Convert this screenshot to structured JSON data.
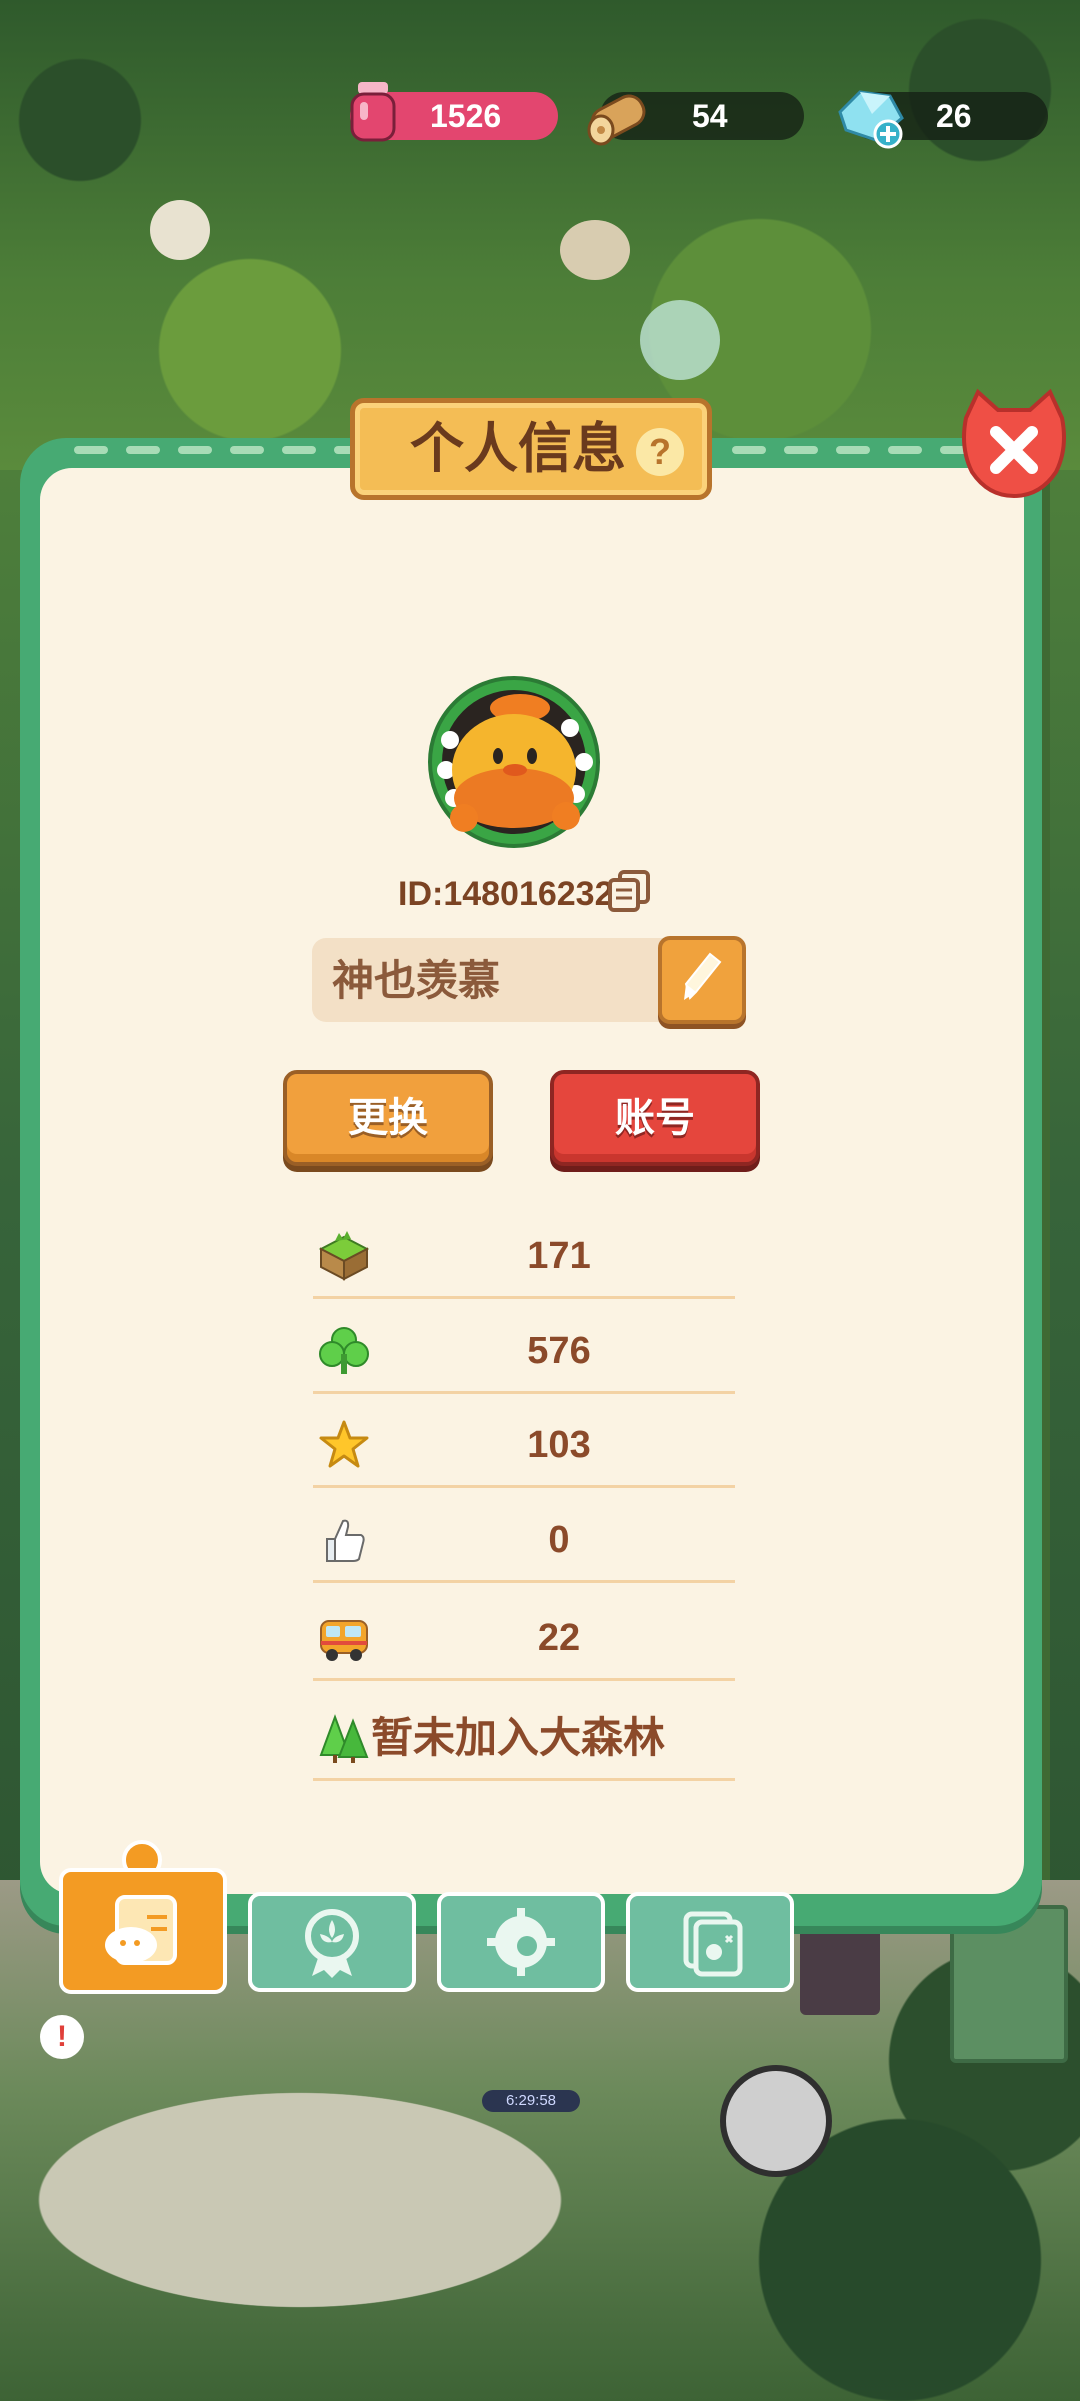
{
  "resources": {
    "ink": {
      "value": "1526",
      "icon": "ink-jar-icon"
    },
    "wood": {
      "value": "54",
      "icon": "wood-log-icon"
    },
    "gem": {
      "value": "26",
      "icon": "gem-plus-icon"
    }
  },
  "panel": {
    "title": "个人信息",
    "help_label": "?",
    "player_id": "ID:148016232",
    "player_name": "神也羡慕",
    "change_button": "更换",
    "account_button": "账号"
  },
  "stats": [
    {
      "icon": "grass-block-icon",
      "value": "171"
    },
    {
      "icon": "clover-icon",
      "value": "576"
    },
    {
      "icon": "star-icon",
      "value": "103"
    },
    {
      "icon": "thumbs-up-icon",
      "value": "0"
    },
    {
      "icon": "bus-icon",
      "value": "22"
    },
    {
      "icon": "forest-icon",
      "value": "暂未加入大森林"
    }
  ],
  "tabs": [
    "profile-tab",
    "badge-tab",
    "settings-tab",
    "album-tab"
  ],
  "background": {
    "timer": "6:29:58",
    "alert": "!"
  },
  "colors": {
    "panel_frame": "#47aa73",
    "panel_bg": "#fbf3e3",
    "title_plate": "#f4bd55",
    "change_button": "#f1a03d",
    "account_button": "#e5463d",
    "ink_pill": "#e3466f",
    "text_brown": "#8b4a2a"
  }
}
